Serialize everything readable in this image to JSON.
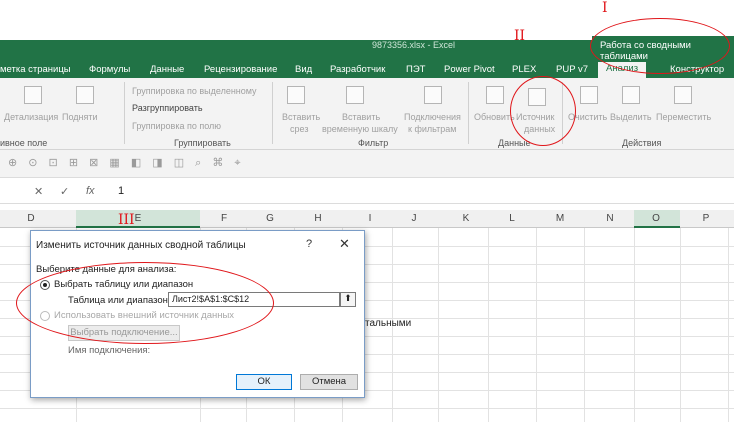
{
  "window": {
    "title": "9873356.xlsx - Excel",
    "context_tab_group": "Работа со сводными таблицами"
  },
  "tabs": [
    "метка страницы",
    "Формулы",
    "Данные",
    "Рецензирование",
    "Вид",
    "Разработчик",
    "ПЭТ",
    "Power Pivot",
    "PLEX",
    "PUP v7",
    "Анализ",
    "Конструктор"
  ],
  "ribbon": {
    "detail": "Детализация",
    "up": "Подняти",
    "active_field_group": "ивное поле",
    "group_by_selection": "Группировка по выделенному",
    "ungroup": "Разгруппировать",
    "group_field": "Группировка по полю",
    "grouping_group": "Группировать",
    "insert_slicer_1": "Вставить",
    "insert_slicer_2": "срез",
    "insert_timeline_1": "Вставить",
    "insert_timeline_2": "временную шкалу",
    "filter_conn_1": "Подключения",
    "filter_conn_2": "к фильтрам",
    "filter_group": "Фильтр",
    "refresh": "Обновить",
    "source_1": "Источник",
    "source_2": "данных",
    "data_group": "Данные",
    "clear": "Очистить",
    "select": "Выделить",
    "move": "Переместить",
    "actions_group": "Действия"
  },
  "formula_bar": {
    "fx": "fx",
    "value": "1"
  },
  "columns": [
    "D",
    "E",
    "F",
    "G",
    "H",
    "I",
    "J",
    "K",
    "L",
    "M",
    "N",
    "O",
    "P"
  ],
  "cell_text": "стальными",
  "dialog": {
    "title": "Изменить источник данных сводной таблицы",
    "help": "?",
    "close": "✕",
    "choose_label": "Выберите данные для анализа:",
    "option_table": "Выбрать таблицу или диапазон",
    "range_label": "Таблица или диапазон:",
    "range_value": "Лист2!$A$1:$C$12",
    "option_external": "Использовать внешний источник данных",
    "choose_connection": "Выбрать подключение...",
    "connection_name": "Имя подключения:",
    "ok": "ОК",
    "cancel": "Отмена"
  },
  "annotations": {
    "a1": "I",
    "a2": "II",
    "a3": "III"
  }
}
